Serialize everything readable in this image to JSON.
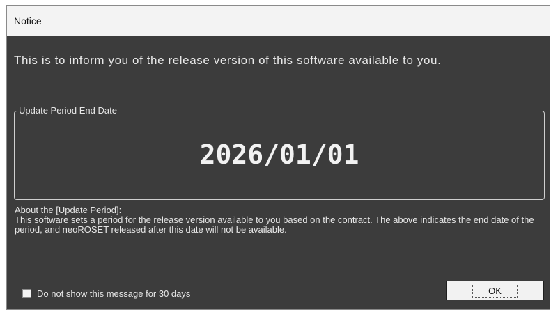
{
  "window": {
    "title": "Notice"
  },
  "message": {
    "info": "This is to inform you of the release version of this software available to you."
  },
  "update_period": {
    "group_label": "Update Period End Date",
    "end_date": "2026/01/01"
  },
  "about": {
    "title": "About the [Update Period]:",
    "body": "This software sets a period for the release version available to you based on the contract. The above indicates the end date of the period, and neoROSET released after this date will not be available."
  },
  "footer": {
    "checkbox_label": "Do not show this message for 30 days",
    "checkbox_checked": false,
    "ok_label": "OK"
  }
}
